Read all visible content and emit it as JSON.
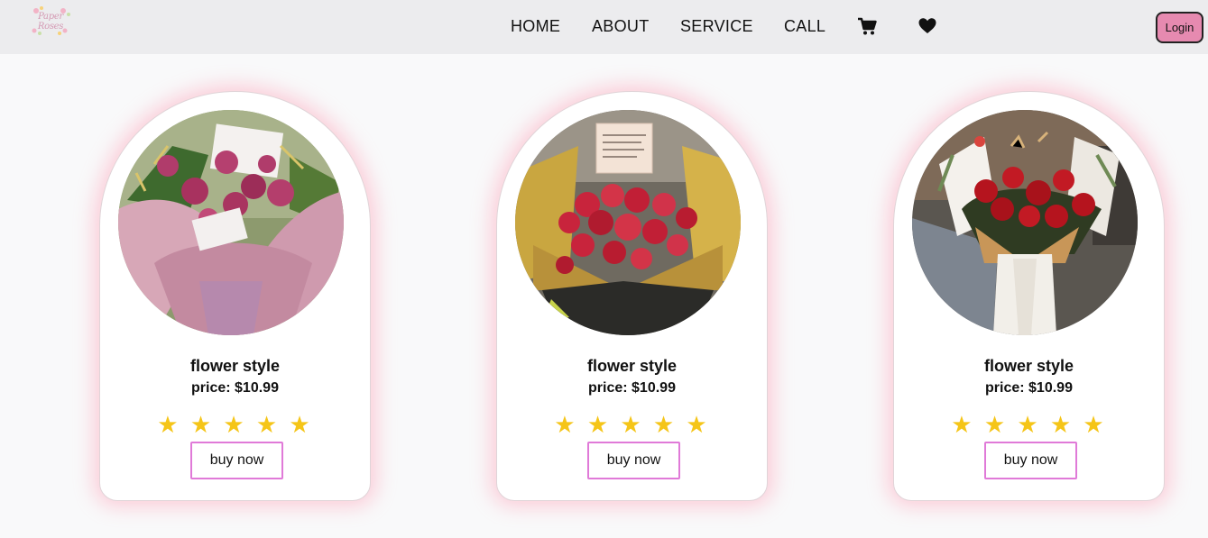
{
  "header": {
    "logo_text": "Paper Roses",
    "nav": [
      "HOME",
      "ABOUT",
      "SERVICE",
      "CALL"
    ],
    "icons": [
      "cart-icon",
      "heart-icon"
    ],
    "login_label": "Login",
    "colors": {
      "background": "#ececee",
      "login_bg": "#e68ab0"
    }
  },
  "products": [
    {
      "title": "flower style",
      "price": "price: $10.99",
      "stars": "★ ★ ★ ★ ★",
      "rating": 5,
      "buy_label": "buy now",
      "image": "pink roses bouquet"
    },
    {
      "title": "flower style",
      "price": "price: $10.99",
      "stars": "★ ★ ★ ★ ★",
      "rating": 5,
      "buy_label": "buy now",
      "image": "red roses in gold wrap"
    },
    {
      "title": "flower style",
      "price": "price: $10.99",
      "stars": "★ ★ ★ ★ ★",
      "rating": 5,
      "buy_label": "buy now",
      "image": "red roses in white wrap"
    }
  ],
  "colors": {
    "star": "#f5c518",
    "buy_border": "#e07ad8",
    "card_glow": "#ff96af"
  }
}
